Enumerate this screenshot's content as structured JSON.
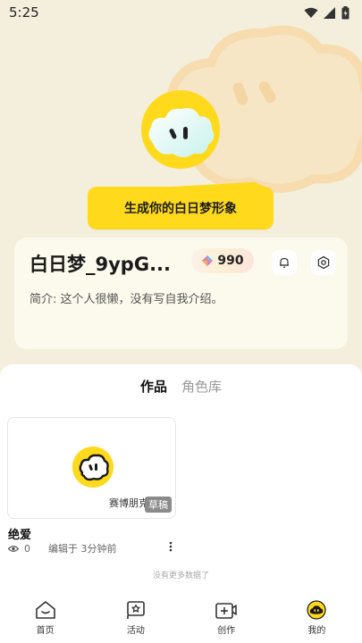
{
  "status_bar": {
    "time": "5:25"
  },
  "header": {
    "generate_button": "生成你的白日梦形象"
  },
  "profile": {
    "username": "白日梦_9ypG...",
    "points": "990",
    "bio": "简介: 这个人很懒，没有写自我介绍。"
  },
  "tabs": [
    {
      "label": "作品",
      "active": true
    },
    {
      "label": "角色库",
      "active": false
    }
  ],
  "works": [
    {
      "title": "绝爱",
      "author": "赛博朋克",
      "badge": "草稿",
      "views": "0",
      "edited": "编辑于 3分钟前"
    }
  ],
  "list_footer": "没有更多数据了",
  "bottom_nav": [
    {
      "label": "首页",
      "icon": "home-icon"
    },
    {
      "label": "活动",
      "icon": "activity-icon"
    },
    {
      "label": "创作",
      "icon": "create-icon"
    },
    {
      "label": "我的",
      "icon": "profile-avatar-icon"
    }
  ],
  "colors": {
    "accent": "#ffd91c",
    "background": "#f3efdc",
    "badge_gray": "#8a8a8a"
  }
}
